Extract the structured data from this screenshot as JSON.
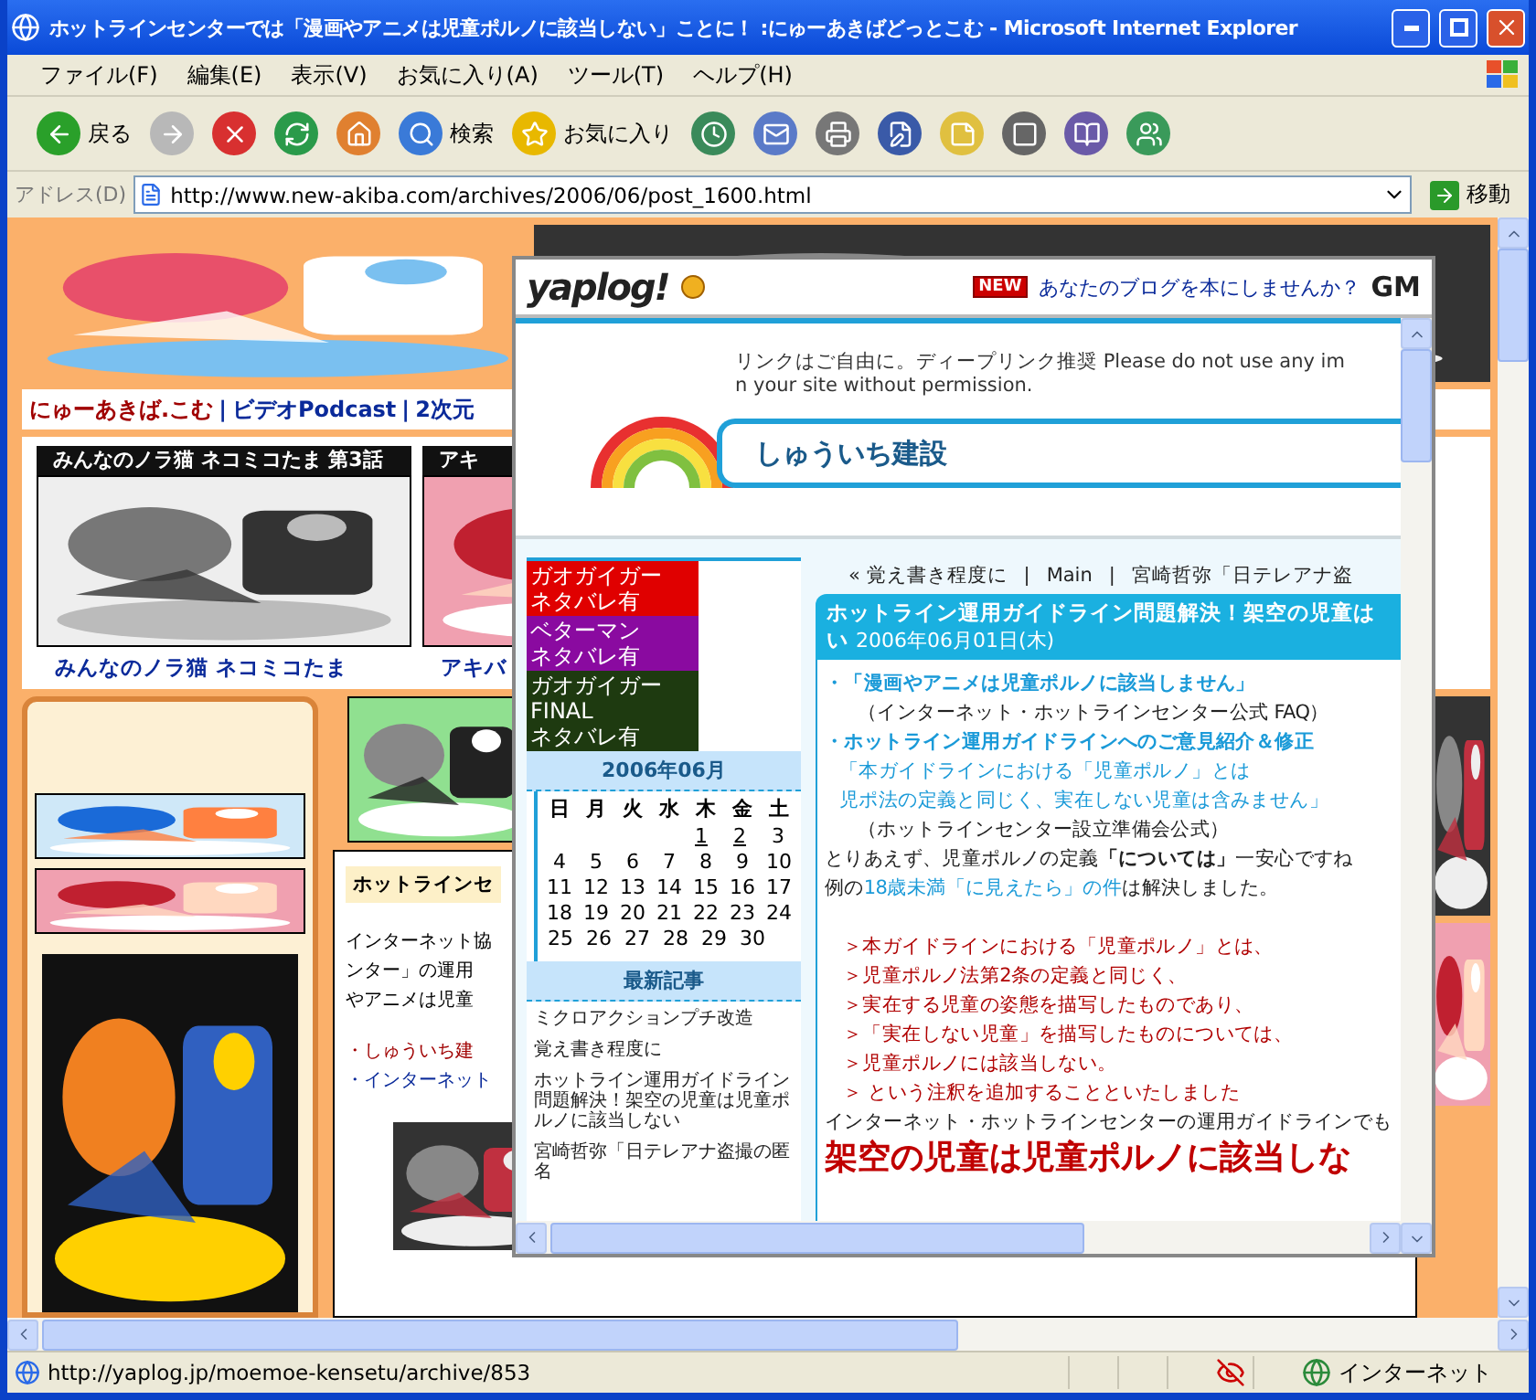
{
  "window": {
    "title": "ホットラインセンターでは「漫画やアニメは児童ポルノに該当しない」ことに！ :にゅーあきばどっとこむ - Microsoft Internet Explorer"
  },
  "menu": [
    "ファイル(F)",
    "編集(E)",
    "表示(V)",
    "お気に入り(A)",
    "ツール(T)",
    "ヘルプ(H)"
  ],
  "toolbar": [
    {
      "kind": "back",
      "label": "戻る",
      "disabled": false
    },
    {
      "kind": "forward",
      "disabled": true
    },
    {
      "kind": "stop"
    },
    {
      "kind": "refresh"
    },
    {
      "kind": "home"
    },
    {
      "kind": "search",
      "label": "検索"
    },
    {
      "kind": "favorites",
      "label": "お気に入り"
    },
    {
      "kind": "history"
    },
    {
      "kind": "mail"
    },
    {
      "kind": "print"
    },
    {
      "kind": "edit"
    },
    {
      "kind": "note"
    },
    {
      "kind": "k"
    },
    {
      "kind": "research"
    },
    {
      "kind": "messenger"
    }
  ],
  "address": {
    "label": "アドレス(D)",
    "value": "http://www.new-akiba.com/archives/2006/06/post_1600.html",
    "go": "移動"
  },
  "page": {
    "nav": [
      {
        "kind": "site",
        "text": "にゅーあきば.こむ"
      },
      {
        "kind": "sep",
        "text": "|"
      },
      {
        "kind": "link",
        "text": "ビデオPodcast"
      },
      {
        "kind": "sep",
        "text": "|"
      },
      {
        "kind": "link",
        "text": "2次元"
      }
    ],
    "thumbs": [
      {
        "caption": "みんなのノラ猫 ネコミコたま 第3話",
        "link": "みんなのノラ猫 ネコミコたま"
      },
      {
        "caption": "アキ",
        "link": "アキバ"
      }
    ],
    "article": {
      "title": "ホットラインセ",
      "lines": [
        "インターネット協",
        "ンター」の運用",
        "やアニメは児童"
      ],
      "links": [
        {
          "text": "・しゅういち建",
          "visited": true
        },
        {
          "text": "・インターネット",
          "visited": false
        }
      ]
    }
  },
  "popup": {
    "logo": "yaplog!",
    "badge": "NEW",
    "promo": "あなたのブログを本にしませんか？",
    "sponsor": "GM",
    "notice": [
      "リンクはご自由に。ディープリンク推奨  Please do not use any im",
      "n your site without permission."
    ],
    "blog_title": "しゅういち建設",
    "banners": [
      {
        "lines": [
          "ガオガイガー",
          "ネタバレ有"
        ],
        "color": "#e00000"
      },
      {
        "lines": [
          "ベターマン",
          "ネタバレ有"
        ],
        "color": "#8a0aa0"
      },
      {
        "lines": [
          "ガオガイガー",
          "FINAL",
          "ネタバレ有"
        ],
        "color": "#1e3a10"
      }
    ],
    "calendar": {
      "title": "2006年06月",
      "weekdays": [
        "日",
        "月",
        "火",
        "水",
        "木",
        "金",
        "土"
      ],
      "weeks": [
        [
          {
            "day": "1",
            "link": true
          },
          {
            "day": "2",
            "link": true
          },
          {
            "day": "3",
            "link": false
          }
        ],
        [
          {
            "day": "4",
            "link": false
          },
          {
            "day": "5",
            "link": false
          },
          {
            "day": "6",
            "link": false
          },
          {
            "day": "7",
            "link": false
          },
          {
            "day": "8",
            "link": false
          },
          {
            "day": "9",
            "link": false
          },
          {
            "day": "10",
            "link": false
          }
        ],
        [
          {
            "day": "11",
            "link": false
          },
          {
            "day": "12",
            "link": false
          },
          {
            "day": "13",
            "link": false
          },
          {
            "day": "14",
            "link": false
          },
          {
            "day": "15",
            "link": false
          },
          {
            "day": "16",
            "link": false
          },
          {
            "day": "17",
            "link": false
          }
        ],
        [
          {
            "day": "18",
            "link": false
          },
          {
            "day": "19",
            "link": false
          },
          {
            "day": "20",
            "link": false
          },
          {
            "day": "21",
            "link": false
          },
          {
            "day": "22",
            "link": false
          },
          {
            "day": "23",
            "link": false
          },
          {
            "day": "24",
            "link": false
          }
        ],
        [
          {
            "day": "25",
            "link": false
          },
          {
            "day": "26",
            "link": false
          },
          {
            "day": "27",
            "link": false
          },
          {
            "day": "28",
            "link": false
          },
          {
            "day": "29",
            "link": false
          },
          {
            "day": "30",
            "link": false
          }
        ]
      ]
    },
    "recent": {
      "title": "最新記事",
      "items": [
        "ミクロアクションプチ改造",
        "覚え書き程度に",
        "ホットライン運用ガイドライン問題解決！架空の児童は児童ポルノに該当しない",
        "宮崎哲弥「日テレアナ盗撮の匿名"
      ]
    },
    "post_nav": [
      "« 覚え書き程度に",
      "|",
      "Main",
      "|",
      "宮崎哲弥「日テレアナ盗"
    ],
    "post": {
      "title": "ホットライン運用ガイドライン問題解決！架空の児童は",
      "title_rest": "い",
      "date": "2006年06月01日(木)",
      "lines": [
        {
          "kind": "heading",
          "text": "・「漫画やアニメは児童ポルノに該当しません」"
        },
        {
          "kind": "source",
          "text": "（インターネット・ホットラインセンター公式 FAQ）"
        },
        {
          "kind": "heading",
          "text": "・ホットライン運用ガイドラインへのご意見紹介＆修正"
        },
        {
          "kind": "quote",
          "text": "「本ガイドラインにおける「児童ポルノ」とは"
        },
        {
          "kind": "quote",
          "text": "児ポ法の定義と同じく、実在しない児童は含みません」"
        },
        {
          "kind": "source",
          "text": "（ホットラインセンター設立準備会公式）"
        },
        {
          "kind": "text",
          "text": "とりあえず、児童ポルノの定義**「については」**一安心ですね"
        },
        {
          "kind": "text",
          "parts": [
            {
              "text": "例の",
              "link": false
            },
            {
              "text": "18歳未満「に見えたら」の件",
              "link": true
            },
            {
              "text": "は解決しました。",
              "link": false
            }
          ]
        },
        {
          "kind": "red",
          "text": "＞本ガイドラインにおける「児童ポルノ」とは、"
        },
        {
          "kind": "red",
          "text": "＞児童ポルノ法第2条の定義と同じく、"
        },
        {
          "kind": "red",
          "text": "＞実在する児童の姿態を描写したものであり、"
        },
        {
          "kind": "red",
          "text": "＞「実在しない児童」を描写したものについては、"
        },
        {
          "kind": "red",
          "text": "＞児童ポルノには該当しない。"
        },
        {
          "kind": "red",
          "text": "＞  という注釈を追加することといたしました"
        },
        {
          "kind": "text",
          "text": "インターネット・ホットラインセンターの運用ガイドラインでも"
        },
        {
          "kind": "big",
          "text": "架空の児童は児童ポルノに該当しな"
        }
      ]
    }
  },
  "status_bar": {
    "url": "http://yaplog.jp/moemoe-kensetu/archive/853",
    "zone": "インターネット"
  }
}
